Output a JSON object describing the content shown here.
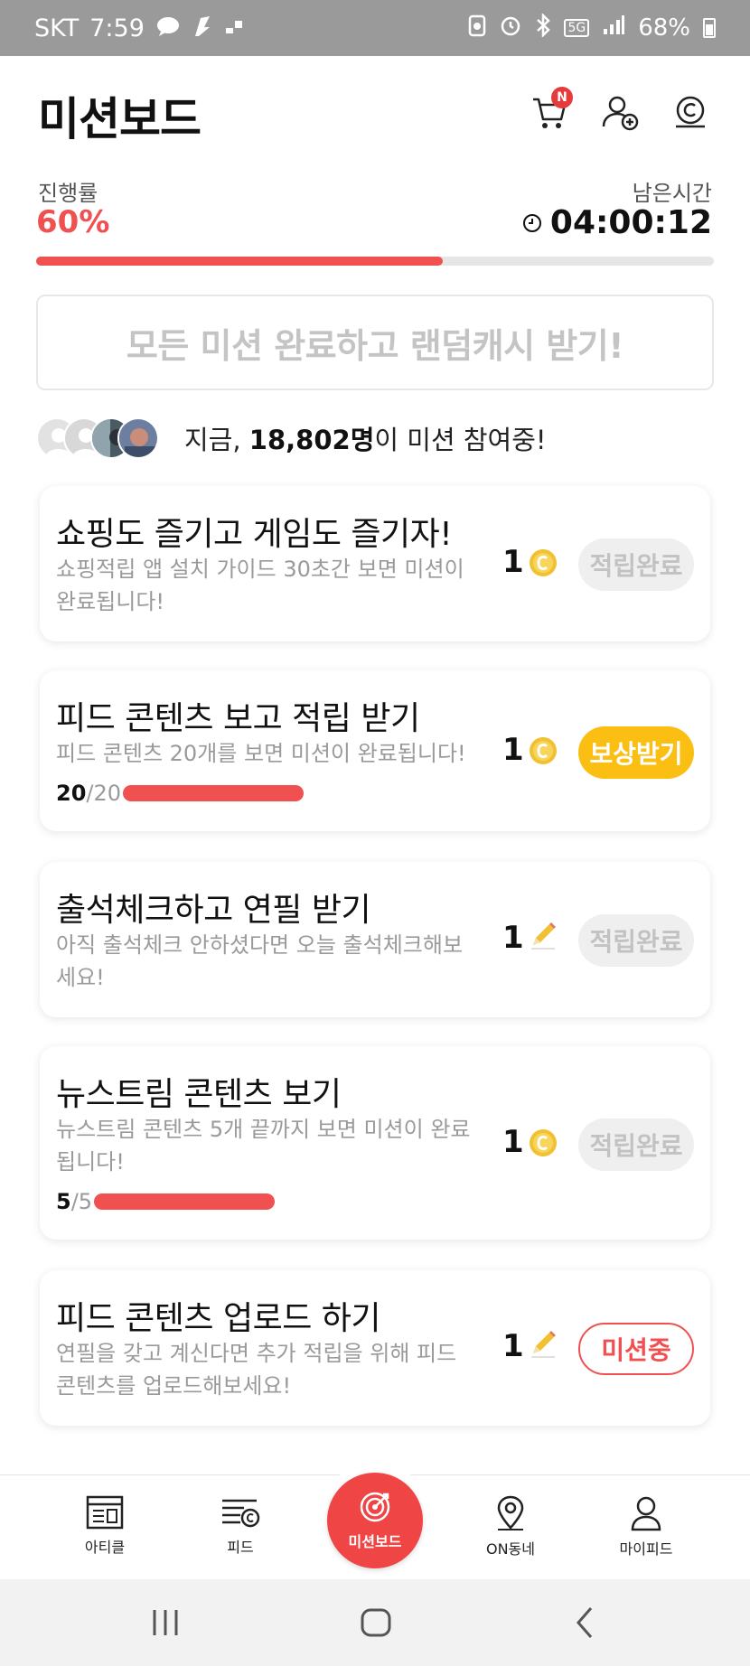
{
  "status_bar": {
    "carrier": "SKT",
    "time": "7:59",
    "network": "5G",
    "battery": "68%"
  },
  "header": {
    "title": "미션보드",
    "cart_badge": "N"
  },
  "progress": {
    "label": "진행률",
    "value": "60%",
    "fraction": 0.6,
    "remaining_label": "남은시간",
    "remaining_time": "04:00:12",
    "color": "#f05050"
  },
  "banner": {
    "text": "모든 미션 완료하고 랜덤캐시 받기!"
  },
  "participants": {
    "prefix": "지금, ",
    "count": "18,802명",
    "suffix": "이 미션 참여중!"
  },
  "missions": [
    {
      "title": "쇼핑도 즐기고 게임도 즐기자!",
      "desc": "쇼핑적립 앱 설치 가이드 30초간 보면 미션이 완료됩니다!",
      "reward_count": "1",
      "reward_icon": "coin-icon",
      "status": "적립완료",
      "status_type": "done"
    },
    {
      "title": "피드 콘텐츠 보고 적립 받기",
      "desc": "피드 콘텐츠 20개를 보면 미션이 완료됩니다!",
      "reward_count": "1",
      "reward_icon": "coin-icon",
      "status": "보상받기",
      "status_type": "claim",
      "progress_current": "20",
      "progress_total": "/20",
      "progress_fraction": 1.0
    },
    {
      "title": "출석체크하고 연필 받기",
      "desc": "아직 출석체크 안하셨다면 오늘 출석체크해보세요!",
      "reward_count": "1",
      "reward_icon": "pencil-icon",
      "status": "적립완료",
      "status_type": "done"
    },
    {
      "title": "뉴스트림 콘텐츠 보기",
      "desc": "뉴스트림 콘텐츠 5개 끝까지 보면 미션이 완료됩니다!",
      "reward_count": "1",
      "reward_icon": "coin-icon",
      "status": "적립완료",
      "status_type": "done",
      "progress_current": "5",
      "progress_total": "/5",
      "progress_fraction": 1.0
    },
    {
      "title": "피드 콘텐츠 업로드 하기",
      "desc": "연필을 갖고 계신다면 추가 적립을 위해 피드 콘텐츠를 업로드해보세요!",
      "reward_count": "1",
      "reward_icon": "pencil-icon",
      "status": "미션중",
      "status_type": "active"
    }
  ],
  "bottom_nav": {
    "article": "아티클",
    "feed": "피드",
    "mission_board": "미션보드",
    "on_dongne": "ON동네",
    "my_feed": "마이피드"
  },
  "colors": {
    "accent": "#f05050",
    "claim": "#fbbf14",
    "coin": "#f2c033"
  }
}
